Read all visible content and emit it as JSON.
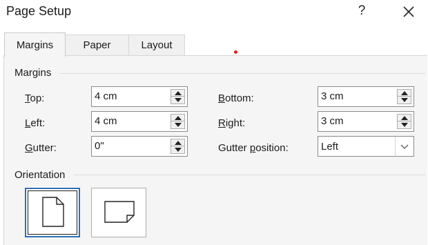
{
  "window": {
    "title": "Page Setup",
    "help_glyph": "?",
    "close_icon": "close-icon"
  },
  "tabs": [
    {
      "label": "Margins",
      "active": true
    },
    {
      "label": "Paper",
      "active": false
    },
    {
      "label": "Layout",
      "active": false
    }
  ],
  "margins": {
    "section_label": "Margins",
    "top": {
      "mnemonic": "T",
      "rest": "op:",
      "value": "4 cm"
    },
    "left": {
      "mnemonic": "L",
      "rest": "eft:",
      "value": "4 cm"
    },
    "gutter": {
      "mnemonic": "G",
      "rest": "utter:",
      "value": "0\""
    },
    "bottom": {
      "mnemonic": "B",
      "rest": "ottom:",
      "value": "3 cm"
    },
    "right": {
      "mnemonic": "R",
      "rest": "ight:",
      "value": "3 cm"
    },
    "gutter_position": {
      "pre": "Gutter ",
      "mnemonic": "p",
      "rest": "osition:",
      "value": "Left"
    }
  },
  "orientation": {
    "section_label": "Orientation",
    "options": [
      "portrait-icon",
      "landscape-icon"
    ],
    "selected": "portrait"
  },
  "colors": {
    "accent": "#2a6fb8",
    "indicator_dot": "#e02020"
  }
}
